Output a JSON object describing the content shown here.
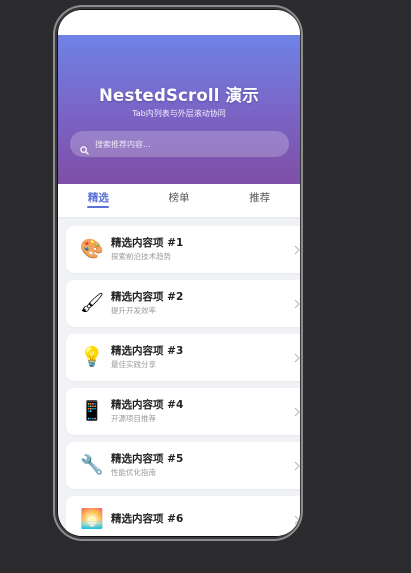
{
  "header": {
    "title": "NestedScroll 演示",
    "subtitle": "Tab内列表与外层滚动协同"
  },
  "search": {
    "placeholder": "搜索推荐内容..."
  },
  "tabs": [
    {
      "label": "精选",
      "active": true
    },
    {
      "label": "榜单",
      "active": false
    },
    {
      "label": "推荐",
      "active": false
    }
  ],
  "items": [
    {
      "icon": "palette-icon",
      "glyph": "🎨",
      "title": "精选内容项 #1",
      "subtitle": "探索前沿技术趋势"
    },
    {
      "icon": "paintbrush-icon",
      "glyph": "🖌",
      "title": "精选内容项 #2",
      "subtitle": "提升开发效率"
    },
    {
      "icon": "lightbulb-icon",
      "glyph": "💡",
      "title": "精选内容项 #3",
      "subtitle": "最佳实践分享"
    },
    {
      "icon": "phone-icon",
      "glyph": "📱",
      "title": "精选内容项 #4",
      "subtitle": "开源项目推荐"
    },
    {
      "icon": "wrench-icon",
      "glyph": "🔧",
      "title": "精选内容项 #5",
      "subtitle": "性能优化指南"
    },
    {
      "icon": "sunrise-icon",
      "glyph": "🌅",
      "title": "精选内容项 #6",
      "subtitle": ""
    }
  ],
  "colors": {
    "accent": "#5a72d8",
    "header_top": "#6f82e6",
    "header_bottom": "#7f4fa6",
    "background": "#f1f2f6"
  }
}
